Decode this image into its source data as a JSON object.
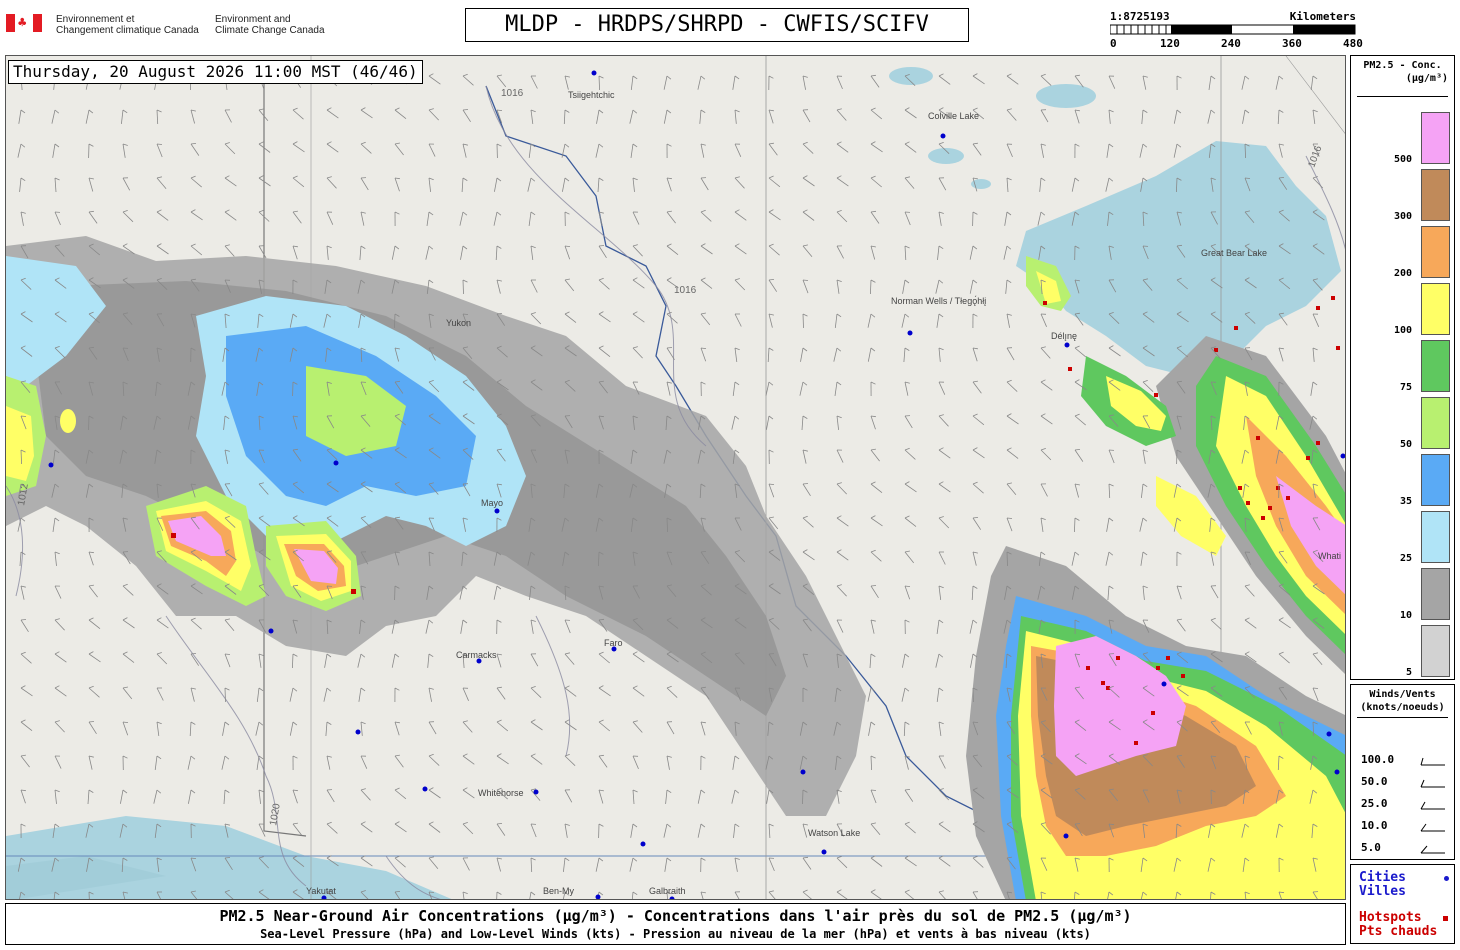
{
  "header": {
    "agency_fr_line1": "Environnement et",
    "agency_fr_line2": "Changement climatique Canada",
    "agency_en_line1": "Environment and",
    "agency_en_line2": "Climate Change Canada",
    "title": "MLDP - HRDPS/SHRPD - CWFIS/SCIFV"
  },
  "scalebar": {
    "ratio": "1:8725193",
    "unit": "Kilometers",
    "ticks": [
      "0",
      "120",
      "240",
      "360",
      "480"
    ]
  },
  "map": {
    "datetime": "Thursday, 20 August 2026 11:00 MST (46/46)",
    "place_names": [
      "Tsiigehtchic",
      "Colville Lake",
      "Norman Wells / Tłegǫ́hłį",
      "Délı̨nę",
      "Great Bear Lake",
      "Carmacks",
      "Whitehorse",
      "Watson Lake",
      "Yakutat",
      "Ben-My",
      "Galbraith",
      "Whati",
      "Yukon",
      "Faro",
      "Mayo"
    ],
    "isobar_labels": [
      "1016",
      "1012",
      "1020",
      "1016",
      "1016"
    ],
    "colors": {
      "land": "#ecebe6",
      "water": "#aad3df",
      "smoke_gray": "#9a9a9a",
      "border": "#333333",
      "city_dot": "#0000cc",
      "hotspot": "#cc0000"
    }
  },
  "footer": {
    "line1": "PM2.5 Near-Ground Air Concentrations (µg/m³) - Concentrations dans l'air près du sol de PM2.5 (µg/m³)",
    "line2": "Sea-Level Pressure (hPa) and Low-Level Winds (kts) - Pression au niveau de la mer (hPa) et vents à bas niveau (kts)"
  },
  "legend_pm": {
    "title_line1": "PM2.5 - Conc.",
    "title_line2": "(µg/m³)",
    "bins": [
      {
        "label": "500",
        "color": "#f5a3f5"
      },
      {
        "label": "300",
        "color": "#c08a5a"
      },
      {
        "label": "200",
        "color": "#f7a85a"
      },
      {
        "label": "100",
        "color": "#ffff66"
      },
      {
        "label": "75",
        "color": "#5fc85f"
      },
      {
        "label": "50",
        "color": "#b8f070"
      },
      {
        "label": "35",
        "color": "#5aaaf5"
      },
      {
        "label": "25",
        "color": "#b0e4f7"
      },
      {
        "label": "10",
        "color": "#a5a5a5"
      },
      {
        "label": "5",
        "color": "#d2d2d2"
      }
    ]
  },
  "legend_wind": {
    "title_line1": "Winds/Vents",
    "title_line2": "(knots/noeuds)",
    "speeds": [
      "100.0",
      "50.0",
      "25.0",
      "10.0",
      "5.0"
    ]
  },
  "legend_places": {
    "cities_en": "Cities",
    "cities_fr": "Villes",
    "hotspots_en": "Hotspots",
    "hotspots_fr": "Pts chauds",
    "city_color": "#1a1acc",
    "hotspot_color": "#cc0000"
  }
}
